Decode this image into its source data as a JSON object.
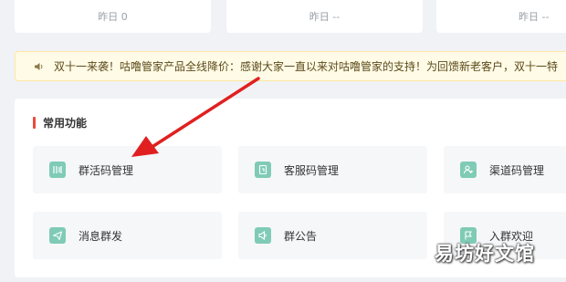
{
  "stats": [
    {
      "text": "昨日 0"
    },
    {
      "text": "昨日 --"
    },
    {
      "text": "昨日 --"
    }
  ],
  "notice": {
    "icon": "speaker-icon",
    "text": "双十一来袭！咕噜管家产品全线降价：感谢大家一直以来对咕噜管家的支持！为回馈新老客户，双十一特"
  },
  "common_functions": {
    "title": "常用功能",
    "accent_color": "#e84b3c",
    "icon_color": "#7fcbb6",
    "items": [
      {
        "label": "群活码管理",
        "icon": "qr-bars-icon"
      },
      {
        "label": "客服码管理",
        "icon": "service-doc-icon"
      },
      {
        "label": "渠道码管理",
        "icon": "channel-people-icon"
      },
      {
        "label": "消息群发",
        "icon": "paper-plane-icon"
      },
      {
        "label": "群公告",
        "icon": "announcement-icon"
      },
      {
        "label": "入群欢迎",
        "icon": "flag-icon"
      }
    ]
  },
  "annotation": {
    "arrow_color": "#e02020"
  },
  "watermark": "易坊好文馆"
}
